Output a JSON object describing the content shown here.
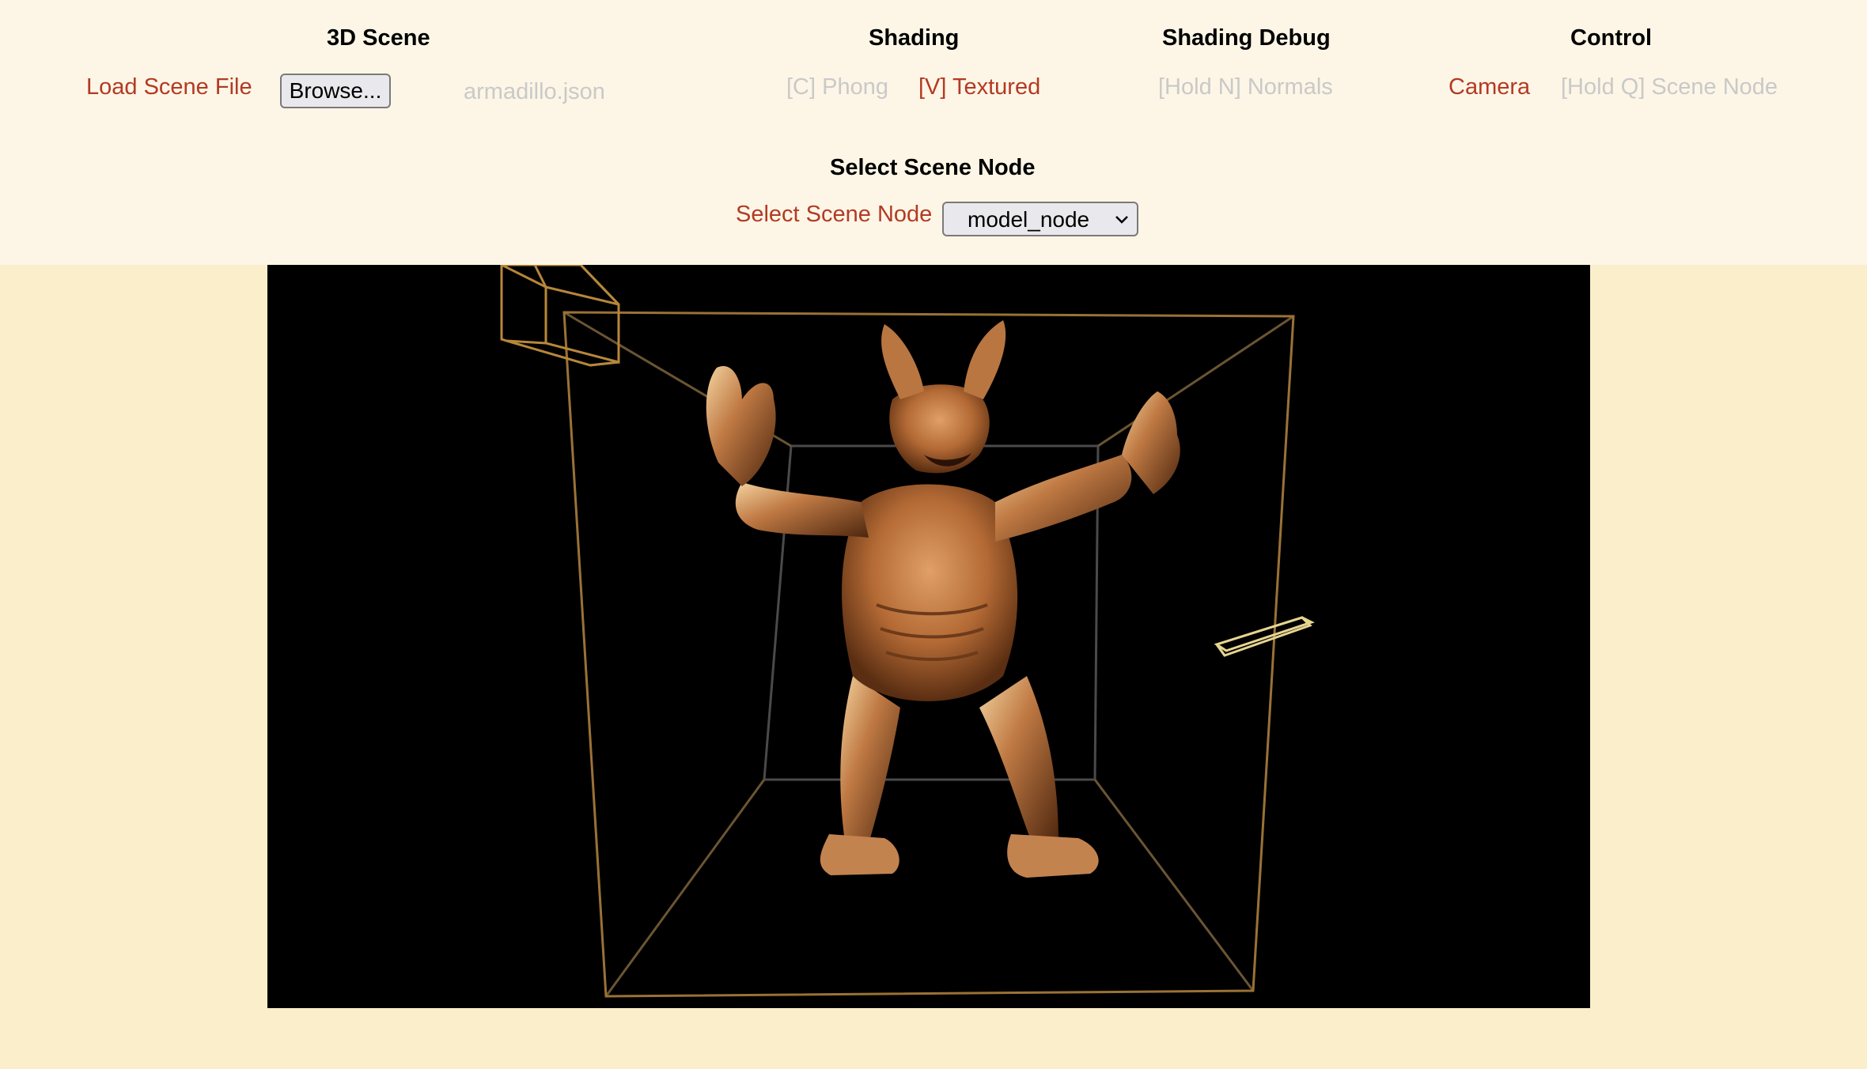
{
  "sections": {
    "scene": {
      "heading": "3D Scene",
      "load_label": "Load Scene File",
      "browse_label": "Browse...",
      "file_name": "armadillo.json"
    },
    "shading": {
      "heading": "Shading",
      "phong_label": "[C] Phong",
      "textured_label": "[V] Textured",
      "selected": "[V] Textured"
    },
    "shading_debug": {
      "heading": "Shading Debug",
      "normals_label": "[Hold N] Normals"
    },
    "control": {
      "heading": "Control",
      "camera_label": "Camera",
      "scene_node_label": "[Hold Q] Scene Node",
      "selected": "Camera"
    }
  },
  "node_select": {
    "heading": "Select Scene Node",
    "label": "Select Scene Node",
    "value": "model_node"
  },
  "colors": {
    "active_text": "#b33a24",
    "inactive_text": "#c9c9c9",
    "panel_bg": "#fdf6e6",
    "page_bg": "#fbeecb",
    "canvas_bg": "#000000",
    "wireframe_gold": "#b7873a",
    "model_tint": "#c47c45"
  },
  "viewport": {
    "model": "armadillo",
    "icons": [
      "bounding-box",
      "camera-frustum",
      "light-gizmo"
    ]
  }
}
